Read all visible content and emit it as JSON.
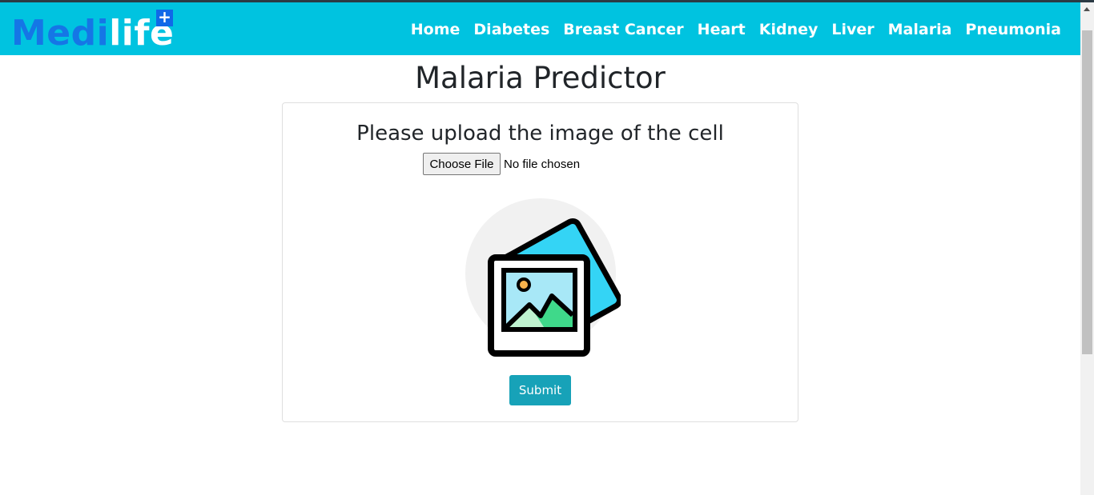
{
  "brand": {
    "name_part1": "Medi",
    "name_part2": "life",
    "badge": "+"
  },
  "nav": {
    "links": [
      "Home",
      "Diabetes",
      "Breast Cancer",
      "Heart",
      "Kidney",
      "Liver",
      "Malaria",
      "Pneumonia"
    ]
  },
  "page": {
    "title": "Malaria Predictor"
  },
  "form": {
    "heading": "Please upload the image of the cell",
    "file_button": "Choose File",
    "file_status": "No file chosen",
    "submit": "Submit",
    "preview_icon": "image-placeholder-icon"
  },
  "colors": {
    "navbar": "#00c3e0",
    "brand_primary": "#1576e6",
    "submit": "#17a2b8"
  }
}
